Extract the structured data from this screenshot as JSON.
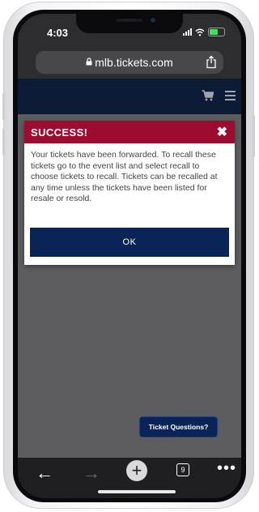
{
  "status_bar": {
    "time": "4:03"
  },
  "browser": {
    "url": "mlb.tickets.com",
    "tab_count": "9"
  },
  "dialog": {
    "title": "SUCCESS!",
    "message": "Your tickets have been forwarded. To recall these tickets go to the event list and select recall to choose tickets to recall. Tickets can be recalled at any time unless the tickets have been listed for resale or resold.",
    "ok_label": "OK"
  },
  "help_button": {
    "label": "Ticket Questions?"
  },
  "colors": {
    "site_header": "#0c1b36",
    "dialog_header": "#9e0b30",
    "primary_button": "#0b2458",
    "page_overlay": "#5d5d5f"
  },
  "battery": {
    "level": 0.6
  }
}
